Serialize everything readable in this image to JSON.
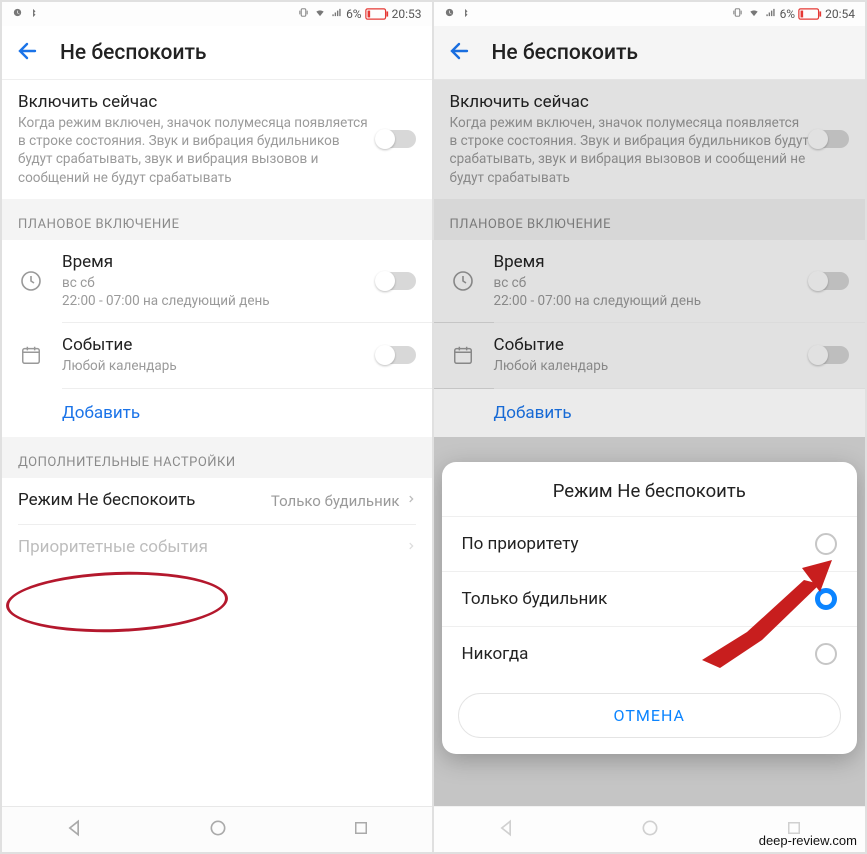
{
  "status": {
    "battery_pct": "6%",
    "time_left": "20:53",
    "time_right": "20:54"
  },
  "header": {
    "title": "Не беспокоить"
  },
  "enable_now": {
    "title": "Включить сейчас",
    "desc": "Когда режим включен, значок полумесяца появляется в строке состояния. Звук и вибрация будильников будут срабатывать, звук и вибрация вызовов и сообщений не будут срабатывать"
  },
  "scheduled_header": "ПЛАНОВОЕ ВКЛЮЧЕНИЕ",
  "time_item": {
    "title": "Время",
    "sub1": "вс сб",
    "sub2": "22:00 - 07:00 на следующий день"
  },
  "event_item": {
    "title": "Событие",
    "sub": "Любой календарь"
  },
  "add_label": "Добавить",
  "extra_header": "ДОПОЛНИТЕЛЬНЫЕ НАСТРОЙКИ",
  "mode_row": {
    "title": "Режим Не беспокоить",
    "value": "Только будильник"
  },
  "priority_row": "Приоритетные события",
  "dialog": {
    "title": "Режим Не беспокоить",
    "opt1": "По приоритету",
    "opt2": "Только будильник",
    "opt3": "Никогда",
    "cancel": "ОТМЕНА"
  },
  "watermark": "deep-review.com"
}
